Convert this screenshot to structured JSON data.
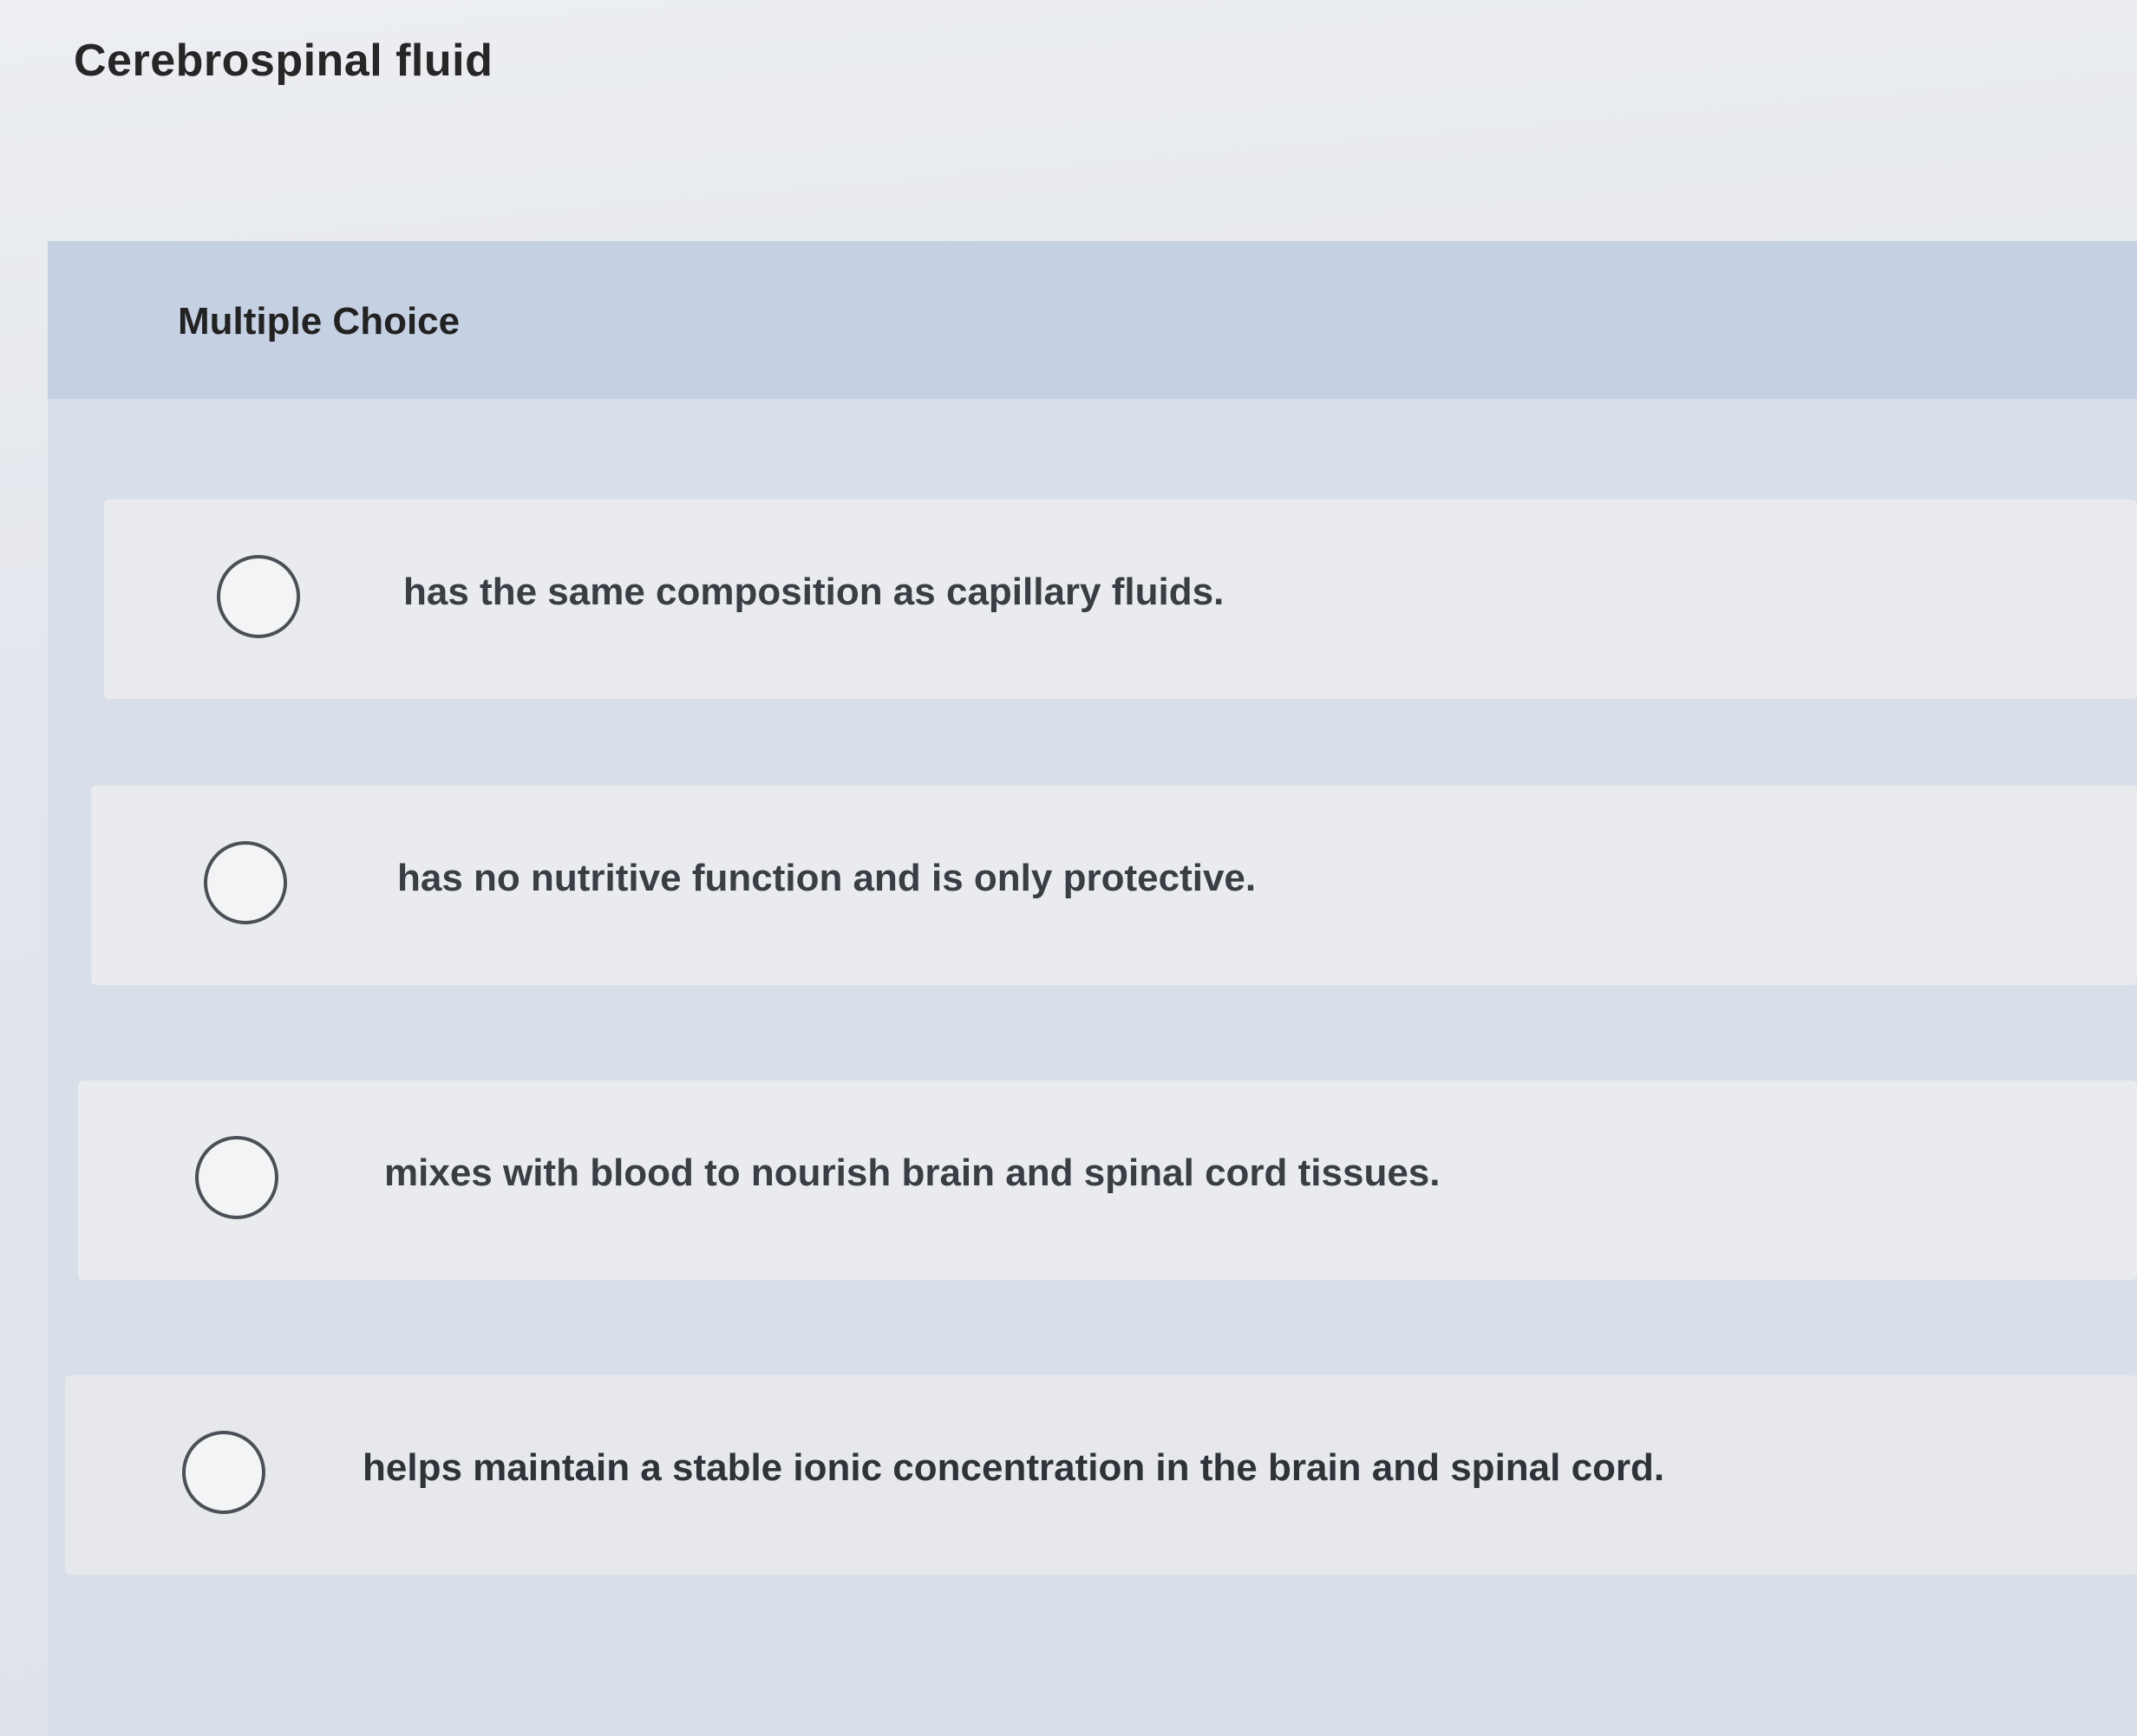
{
  "question": {
    "title": "Cerebrospinal fluid",
    "type_label": "Multiple Choice"
  },
  "options": [
    {
      "label": "has the same composition as capillary fluids."
    },
    {
      "label": "has no nutritive function and is only protective."
    },
    {
      "label": "mixes with blood to nourish brain and spinal cord tissues."
    },
    {
      "label": "helps maintain a stable ionic concentration in the brain and spinal cord."
    }
  ]
}
